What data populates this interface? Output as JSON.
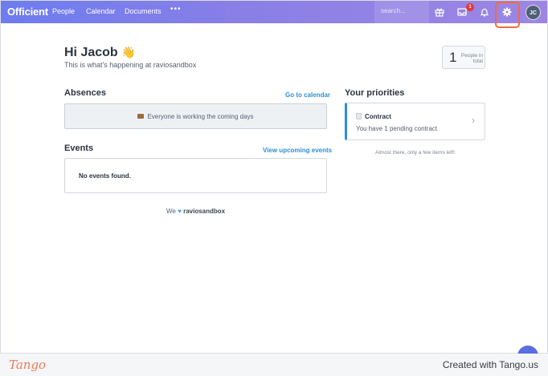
{
  "nav": {
    "logo": "Officient",
    "items": [
      "People",
      "Calendar",
      "Documents"
    ],
    "more": "•••",
    "search_placeholder": "search...",
    "inbox_badge": "1",
    "avatar_initials": "JC",
    "icons": [
      "gift-icon",
      "inbox-icon",
      "bell-icon",
      "gear-icon"
    ]
  },
  "greeting": {
    "title": "Hi Jacob",
    "emoji": "👋",
    "subtitle": "This is what's happening at raviosandbox"
  },
  "people": {
    "count": "1",
    "label": "People in total"
  },
  "absences": {
    "title": "Absences",
    "link": "Go to calendar",
    "message": "Everyone is working the coming days"
  },
  "events": {
    "title": "Events",
    "link": "View upcoming events",
    "empty": "No events found."
  },
  "footer_love": {
    "prefix": "We",
    "heart": "♥",
    "company": "raviosandbox"
  },
  "priorities": {
    "title": "Your priorities",
    "card_title": "Contract",
    "card_subtitle": "You have 1 pending contract",
    "chevron": "›",
    "note": "Almost there, only a few items left!"
  },
  "branding": {
    "logo": "Tango",
    "created": "Created with Tango.us"
  },
  "colors": {
    "accent": "#2d8fd5",
    "nav_start": "#6d7cf0",
    "nav_end": "#9d86e3",
    "highlight": "#ef6d3e",
    "badge": "#e53935"
  }
}
